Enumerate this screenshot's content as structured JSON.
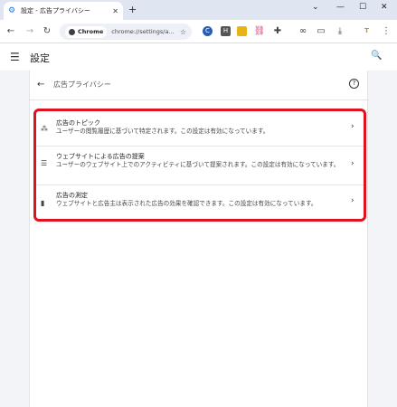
{
  "tab": {
    "title": "設定 - 広告プライバシー"
  },
  "omnibox": {
    "chip": "Chrome",
    "url": "chrome://settings/a..."
  },
  "extensions": [
    "C",
    "H",
    "T"
  ],
  "colors": {
    "highlight": "#e0121e",
    "accent": "#1a73e8"
  },
  "header": {
    "title": "設定"
  },
  "page": {
    "title": "広告プライバシー"
  },
  "items": [
    {
      "icon": "ad-topics-icon",
      "title": "広告のトピック",
      "desc": "ユーザーの閲覧履歴に基づいて特定されます。この設定は有効になっています。"
    },
    {
      "icon": "site-suggested-ads-icon",
      "title": "ウェブサイトによる広告の提案",
      "desc": "ユーザーのウェブサイト上でのアクティビティに基づいて提案されます。この設定は有効になっています。"
    },
    {
      "icon": "ad-measurement-icon",
      "title": "広告の測定",
      "desc": "ウェブサイトと広告主は表示された広告の効果を確認できます。この設定は有効になっています。"
    }
  ]
}
